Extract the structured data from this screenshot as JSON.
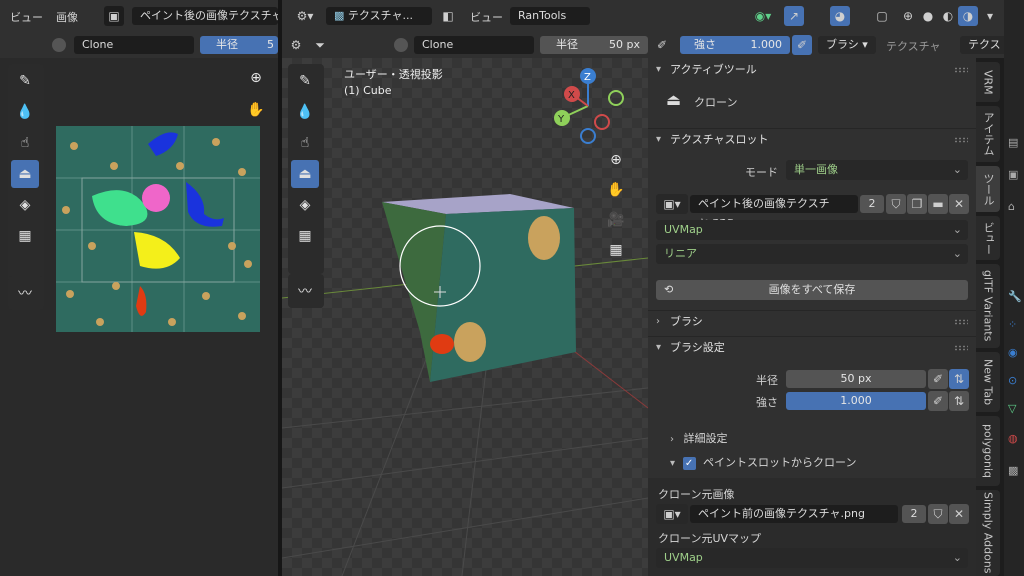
{
  "left_editor": {
    "header": {
      "menu_view": "ビュー",
      "menu_image": "画像",
      "image_name": "ペイント後の画像テクスチャ"
    },
    "tool_header": {
      "brush": "Clone",
      "radius_label": "半径",
      "radius_value": "5"
    }
  },
  "viewport": {
    "header": {
      "mode": "テクスチャ...",
      "menu_view": "ビュー",
      "addon_menu": "RanTools"
    },
    "tool_header": {
      "brush": "Clone",
      "radius_label": "半径",
      "radius_value": "50 px",
      "strength_label": "強さ",
      "strength_value": "1.000",
      "brush_menu": "ブラシ",
      "texture_menu": "テクスチャ",
      "texture_menu2": "テクス"
    },
    "overlay": {
      "projection": "ユーザー・透視投影",
      "object": "(1) Cube"
    },
    "gizmo": {
      "x": "X",
      "y": "Y",
      "z": "Z"
    }
  },
  "properties": {
    "active_tool": {
      "title": "アクティブツール",
      "tool_name": "クローン"
    },
    "texture_slots": {
      "title": "テクスチャスロット",
      "mode_label": "モード",
      "mode_value": "単一画像",
      "image_name": "ペイント後の画像テクスチャ.png",
      "users": "2",
      "uv_map": "UVMap",
      "interpolation": "リニア",
      "save_all": "画像をすべて保存"
    },
    "brush": {
      "title": "ブラシ"
    },
    "brush_settings": {
      "title": "ブラシ設定",
      "radius_label": "半径",
      "radius_value": "50 px",
      "strength_label": "強さ",
      "strength_value": "1.000",
      "advanced": "詳細設定",
      "clone_from_slot": "ペイントスロットからクローン",
      "clone_checked": true,
      "clone_image_label": "クローン元画像",
      "clone_image_name": "ペイント前の画像テクスチャ.png",
      "clone_image_users": "2",
      "clone_uv_label": "クローン元UVマップ",
      "clone_uv_value": "UVMap"
    }
  },
  "sidebar_tabs": [
    "VRM",
    "アイテム",
    "ツール",
    "ビュー",
    "glTF Variants",
    "New Tab",
    "polygoniq",
    "Simply Addons"
  ],
  "colors": {
    "accent_blue": "#4772b3",
    "panel": "#303030",
    "header": "#303030",
    "green_text": "#9fd08a"
  }
}
